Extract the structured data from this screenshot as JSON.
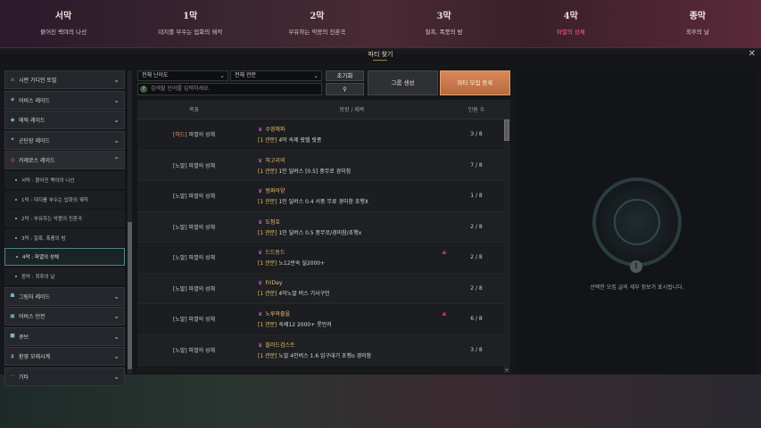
{
  "chapters": [
    {
      "num": "서막",
      "sub": "붉어진 백야의 나선",
      "active": false
    },
    {
      "num": "1막",
      "sub": "대지를 부수는 업화의 궤적",
      "active": false
    },
    {
      "num": "2막",
      "sub": "부유하는 악몽의 진혼곡",
      "active": false
    },
    {
      "num": "3막",
      "sub": "칠흑, 폭풍의 밤",
      "active": false
    },
    {
      "num": "4막",
      "sub": "파멸의 성채",
      "active": true
    },
    {
      "num": "종막",
      "sub": "최후의 날",
      "active": false
    }
  ],
  "window": {
    "title": "파티 찾기",
    "close": "✕"
  },
  "sidebar": {
    "items": [
      {
        "label": "시련 가디언 토벌",
        "icon": "⚔"
      },
      {
        "label": "어비스 레이드",
        "icon": "◈"
      },
      {
        "label": "에픽 레이드",
        "icon": "◆"
      },
      {
        "label": "군단장 레이드",
        "icon": "✦"
      },
      {
        "label": "카제로스 레이드",
        "icon": "◎"
      }
    ],
    "subitems": [
      {
        "label": "서막 : 붉어진 백야의 나선"
      },
      {
        "label": "1막 : 대지를 부수는 업화의 궤적"
      },
      {
        "label": "2막 : 부유하는 악몽의 진혼곡"
      },
      {
        "label": "3막 : 칠흑, 폭풍의 밤"
      },
      {
        "label": "4막 : 파멸의 성채"
      },
      {
        "label": "종막 : 최후의 날"
      }
    ],
    "items2": [
      {
        "label": "그림자 레이드",
        "icon": "☗"
      },
      {
        "label": "어비스 던전",
        "icon": "▣"
      },
      {
        "label": "큐브",
        "icon": "■"
      },
      {
        "label": "환영 모래시계",
        "icon": "⧗"
      },
      {
        "label": "기타",
        "icon": "⋯"
      }
    ]
  },
  "filters": {
    "difficulty": "전체 난이도",
    "type": "전체 관문",
    "reset": "초기화",
    "search_placeholder": "검색할 단어를 입력하세요.",
    "search_btn": "⚲",
    "create_group": "그룹 생성",
    "register": "파티 모집 등록"
  },
  "table": {
    "headers": [
      "목표",
      "방장 / 제목",
      "인원 수"
    ],
    "rows": [
      {
        "tag": "[하드]",
        "target": " 파멸의 성채",
        "name": "수영해파",
        "gate": "[1 관문]",
        "desc": " 4막 숙제 랏텔 랏퐁",
        "count": "3 / 8",
        "lock": false
      },
      {
        "tag": "",
        "target": "[노말] 파멸의 성채",
        "name": "하고리의",
        "gate": "[1 관문]",
        "desc": " 1인 딜버스 [0.5] 풍무로 경미참",
        "count": "7 / 8",
        "lock": false
      },
      {
        "tag": "",
        "target": "[노말] 파멸의 성채",
        "name": "범짜아양",
        "gate": "[1 관문]",
        "desc": " 1인 딜버스 0.4 서풍 무료 경미참 초행X",
        "count": "1 / 8",
        "lock": false
      },
      {
        "tag": "",
        "target": "[노말] 파멸의 성채",
        "name": "도첨호",
        "gate": "[1 관문]",
        "desc": " 1인 딜버스 0.5 풍무로/경미참/초행x",
        "count": "2 / 8",
        "lock": false
      },
      {
        "tag": "",
        "target": "[노말] 파멸의 성채",
        "name": "드드등드",
        "gate": "[1 관문]",
        "desc": " 노12반숙 딜2000+",
        "count": "2 / 8",
        "lock": true
      },
      {
        "tag": "",
        "target": "[노말] 파멸의 성채",
        "name": "FriDay",
        "gate": "[1 관문]",
        "desc": " 4막노말 버스 기사구인",
        "count": "2 / 8",
        "lock": false
      },
      {
        "tag": "",
        "target": "[노말] 파멸의 성채",
        "name": "노루와줄을",
        "gate": "[1 관문]",
        "desc": " 숙제12 2000+ 룻언저",
        "count": "6 / 8",
        "lock": true
      },
      {
        "tag": "",
        "target": "[노말] 파멸의 성채",
        "name": "블러드검스트",
        "gate": "[1 관문]",
        "desc": " 노말 4인버스 1.6 입구대기 초행o 경미참",
        "count": "3 / 8",
        "lock": false
      }
    ]
  },
  "detail": {
    "message": "선택한 모집 글의 세부 정보가 표시됩니다.",
    "icon": "!"
  }
}
